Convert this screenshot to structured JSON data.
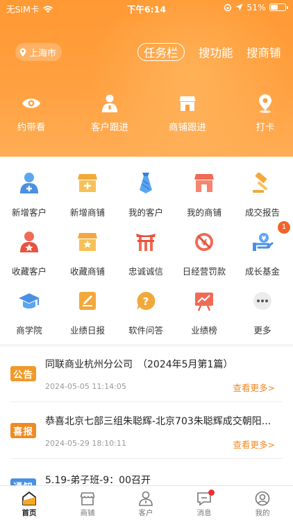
{
  "status": {
    "carrier": "无SIM卡",
    "time": "下午6:14",
    "battery": "51%",
    "battery_level": 0.51
  },
  "header": {
    "city": "上海市",
    "links": [
      {
        "label": "任务栏",
        "active": true
      },
      {
        "label": "搜功能"
      },
      {
        "label": "搜商铺"
      }
    ],
    "quick": [
      {
        "label": "约带看",
        "icon": "eye-icon"
      },
      {
        "label": "客户跟进",
        "icon": "person-icon"
      },
      {
        "label": "商铺跟进",
        "icon": "shop-icon"
      },
      {
        "label": "打卡",
        "icon": "location-pin-icon"
      }
    ]
  },
  "grid": [
    {
      "label": "新增客户",
      "icon": "add-customer-icon"
    },
    {
      "label": "新增商铺",
      "icon": "add-shop-icon"
    },
    {
      "label": "我的客户",
      "icon": "tie-icon"
    },
    {
      "label": "我的商铺",
      "icon": "my-shop-icon"
    },
    {
      "label": "成交报告",
      "icon": "gavel-icon"
    },
    {
      "label": "收藏客户",
      "icon": "favorite-customer-icon"
    },
    {
      "label": "收藏商铺",
      "icon": "favorite-shop-icon"
    },
    {
      "label": "忠诚诚信",
      "icon": "gate-icon"
    },
    {
      "label": "日经营罚款",
      "icon": "penalty-icon"
    },
    {
      "label": "成长基金",
      "icon": "fund-icon",
      "badge": "1"
    },
    {
      "label": "商学院",
      "icon": "graduation-cap-icon"
    },
    {
      "label": "业绩日报",
      "icon": "report-icon"
    },
    {
      "label": "软件问答",
      "icon": "question-icon"
    },
    {
      "label": "业绩榜",
      "icon": "chart-board-icon"
    },
    {
      "label": "更多",
      "icon": "more-icon"
    }
  ],
  "notices": [
    {
      "tag": "公告",
      "color": "#f09a2a",
      "title": "同联商业杭州分公司　（2024年5月第1篇）",
      "date": "2024-05-05 11:14:05",
      "more": "查看更多>"
    },
    {
      "tag": "喜报",
      "color": "#f08a22",
      "title": "恭喜北京七部三组朱聪辉-北京703朱聪辉成交朝阳...",
      "date": "2024-05-29 18:10:11",
      "more": "查看更多>"
    },
    {
      "tag": "通知",
      "color": "#4a90e2",
      "title": "5.19-弟子班-9：00召开",
      "date": "",
      "more": ""
    }
  ],
  "tabs": [
    {
      "label": "首页",
      "icon": "home-icon",
      "active": true
    },
    {
      "label": "商铺",
      "icon": "store-icon"
    },
    {
      "label": "客户",
      "icon": "customer-icon"
    },
    {
      "label": "消息",
      "icon": "message-icon",
      "dot": true
    },
    {
      "label": "我的",
      "icon": "profile-icon"
    }
  ],
  "colors": {
    "primary": "#ff9933",
    "accent_text": "#f0881f",
    "badge": "#f0642b"
  }
}
